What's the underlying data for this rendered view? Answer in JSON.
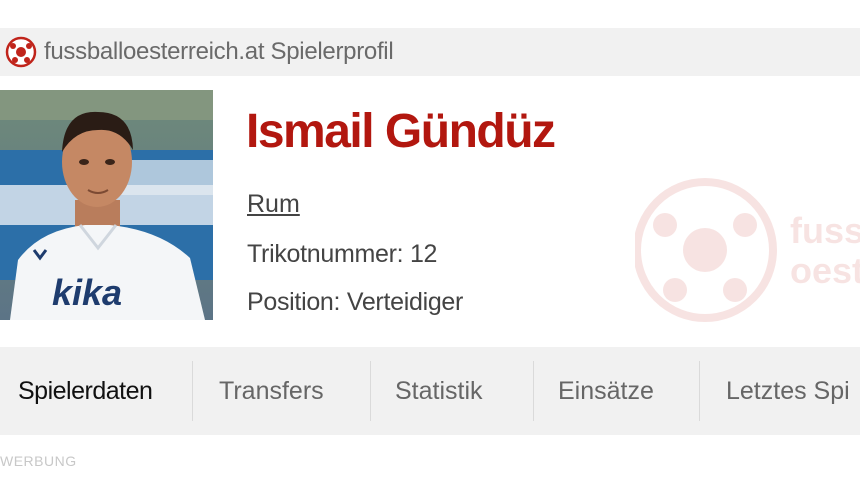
{
  "header": {
    "icon": "soccer-ball-icon",
    "title": "fussballoesterreich.at Spielerprofil"
  },
  "player": {
    "name": "Ismail Gündüz",
    "club": "Rum",
    "shirt_line": "Trikotnummer: 12",
    "position_line": "Position: Verteidiger",
    "photo_shirt_text": "kika"
  },
  "watermark": {
    "text_line1": "fuss",
    "text_line2": "oest"
  },
  "tabs": [
    {
      "label": "Spielerdaten",
      "active": true
    },
    {
      "label": "Transfers",
      "active": false
    },
    {
      "label": "Statistik",
      "active": false
    },
    {
      "label": "Einsätze",
      "active": false
    },
    {
      "label": "Letztes Spi",
      "active": false
    }
  ],
  "ad": {
    "label": "WERBUNG"
  },
  "colors": {
    "accent": "#b2170f",
    "bar_background": "#f1f1f1",
    "text": "#444444"
  }
}
